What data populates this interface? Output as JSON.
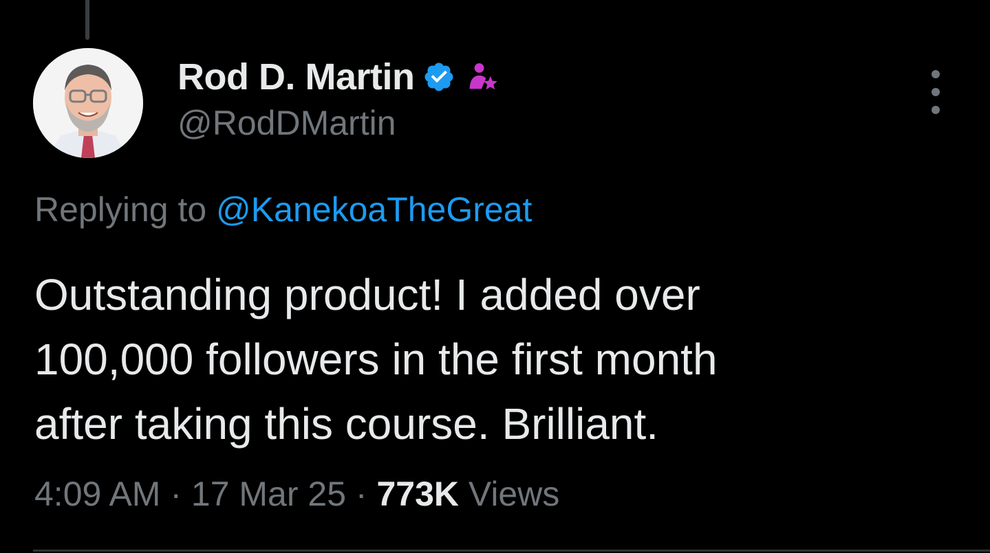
{
  "author": {
    "display_name": "Rod D. Martin",
    "handle": "@RodDMartin",
    "verified_icon": "verified-badge-icon",
    "affiliate_icon": "person-star-icon"
  },
  "reply": {
    "prefix": "Replying to ",
    "to_handle": "@KanekoaTheGreat"
  },
  "tweet": {
    "lines": [
      "Outstanding product! I added over",
      "100,000 followers in the first month",
      "after taking this course. Brilliant."
    ]
  },
  "meta": {
    "time": "4:09 AM",
    "separator": " · ",
    "date": "17 Mar 25",
    "views_count": "773K",
    "views_label": " Views"
  },
  "colors": {
    "background": "#000000",
    "primary_text": "#e7e9ea",
    "secondary_text": "#71767b",
    "link": "#1d9bf0",
    "verified": "#1d9bf0",
    "affiliate": "#c936cc"
  }
}
